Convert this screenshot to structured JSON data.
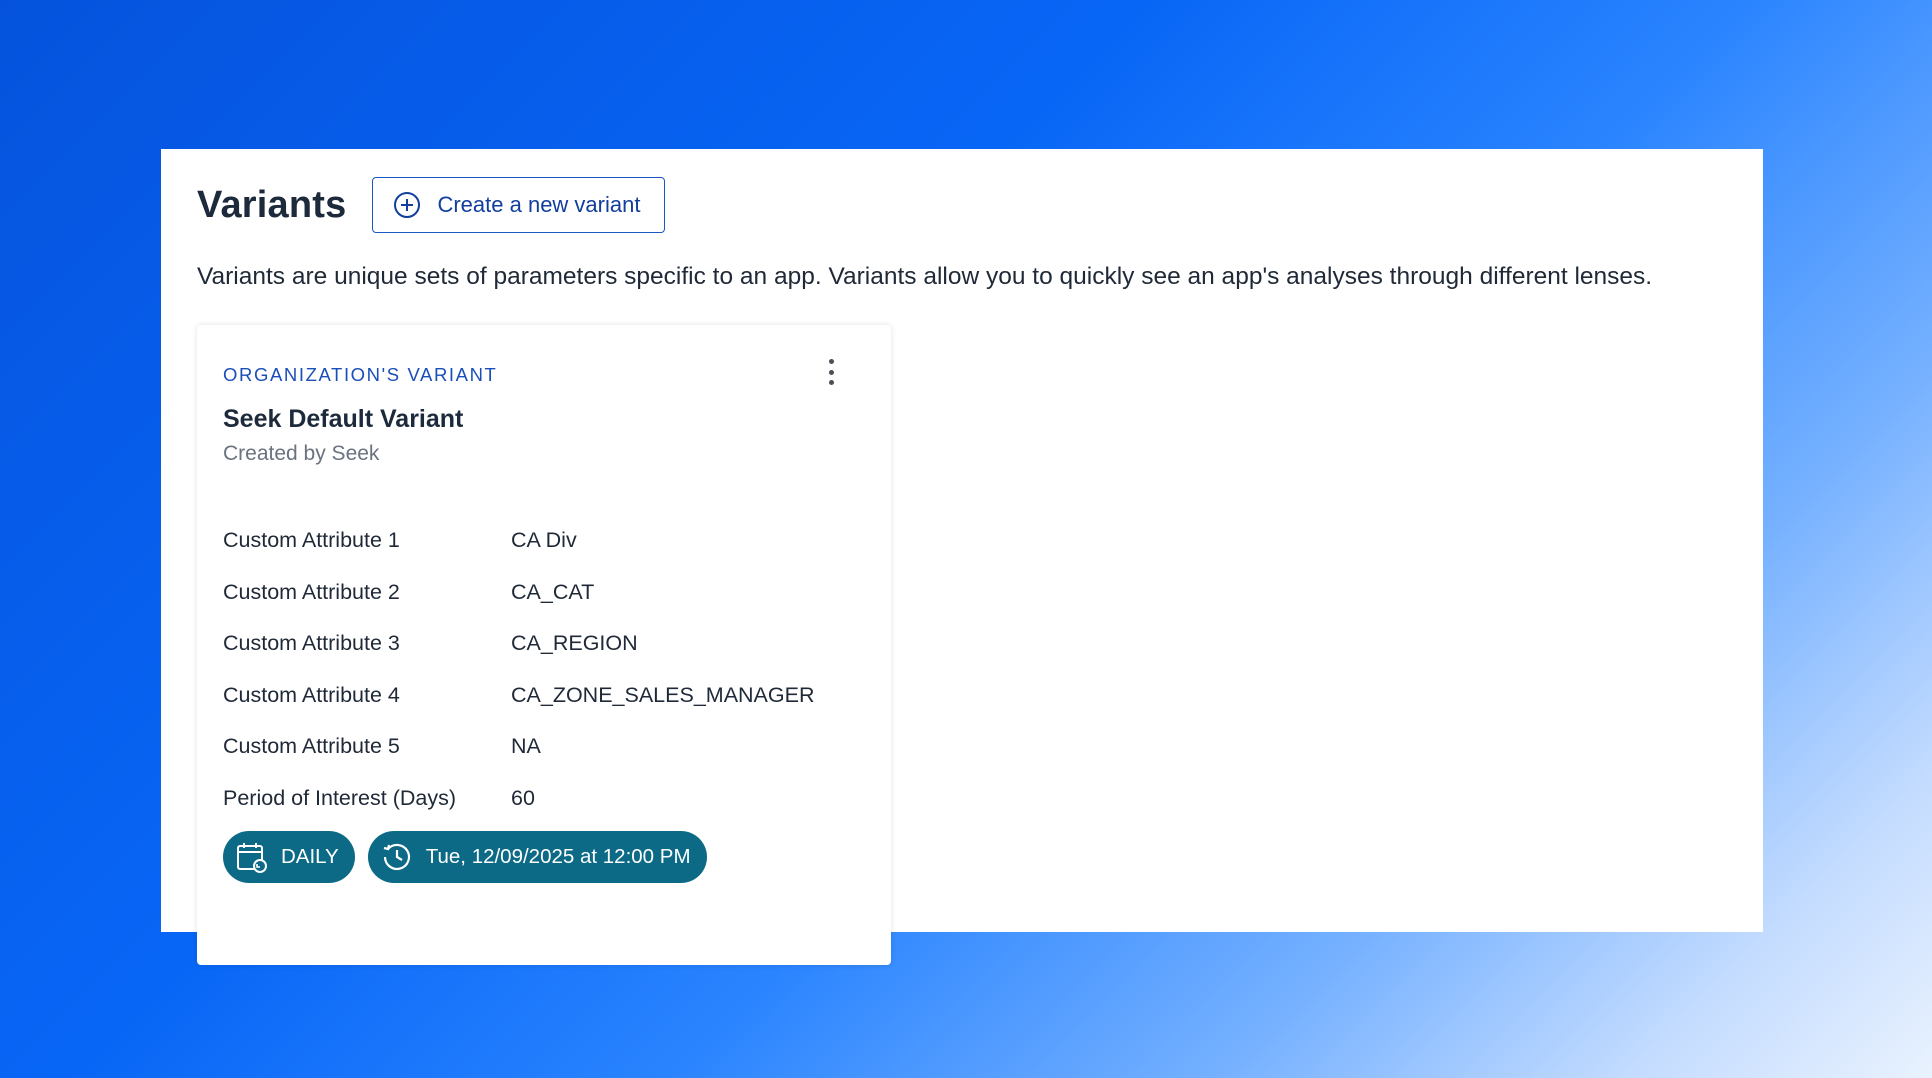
{
  "page": {
    "title": "Variants",
    "create_button_label": "Create a new variant",
    "description": "Variants are unique sets of parameters specific to an app. Variants allow you to quickly see an app's analyses through different lenses."
  },
  "variant_card": {
    "type_label": "ORGANIZATION'S VARIANT",
    "name": "Seek Default Variant",
    "created_by": "Created by Seek",
    "attributes": [
      {
        "label": "Custom Attribute 1",
        "value": "CA Div"
      },
      {
        "label": "Custom Attribute 2",
        "value": "CA_CAT"
      },
      {
        "label": "Custom Attribute 3",
        "value": "CA_REGION"
      },
      {
        "label": "Custom Attribute 4",
        "value": "CA_ZONE_SALES_MANAGER"
      },
      {
        "label": "Custom Attribute 5",
        "value": "NA"
      },
      {
        "label": "Period of Interest (Days)",
        "value": "60"
      }
    ],
    "schedule": {
      "frequency": "DAILY",
      "frequency_icon": "calendar-repeat-icon",
      "next_run": "Tue, 12/09/2025 at 12:00 PM",
      "next_run_icon": "clock-history-icon"
    },
    "menu_icon": "kebab-menu-icon"
  },
  "colors": {
    "accent": "#1a56c4",
    "chip_background": "#0c6a86",
    "title_text": "#1d2a3c"
  }
}
